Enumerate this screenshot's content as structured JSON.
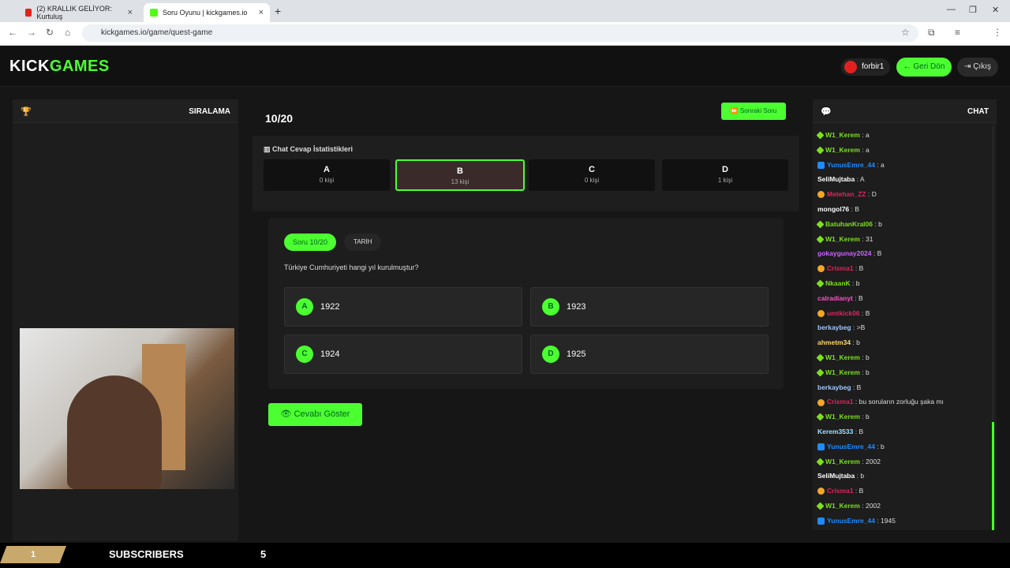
{
  "browser": {
    "tab1": "(2) KRALLIK GELİYOR: Kurtuluş",
    "tab2": "Soru Oyunu | kickgames.io",
    "url": "kickgames.io/game/quest-game"
  },
  "header": {
    "logo_kick": "KICK",
    "logo_games": "GAMES",
    "username": "forbir1",
    "back": "Geri Dön",
    "exit": "Çıkış"
  },
  "ranking": {
    "title": "SIRALAMA"
  },
  "game": {
    "question_number": "10/20",
    "next": "Sonraki Soru",
    "stats_title": "Chat Cevap İstatistikleri",
    "stats": [
      {
        "letter": "A",
        "count": "0 kişi"
      },
      {
        "letter": "B",
        "count": "13 kişi"
      },
      {
        "letter": "C",
        "count": "0 kişi"
      },
      {
        "letter": "D",
        "count": "1 kişi"
      }
    ],
    "pill": "Soru 10/20",
    "category": "TARİH",
    "question": "Türkiye Cumhuriyeti hangi yıl kurulmuştur?",
    "answers": [
      {
        "letter": "A",
        "text": "1922"
      },
      {
        "letter": "B",
        "text": "1923"
      },
      {
        "letter": "C",
        "text": "1924"
      },
      {
        "letter": "D",
        "text": "1925"
      }
    ],
    "show_answer": "Cevabı Göster"
  },
  "chat": {
    "title": "CHAT",
    "messages": [
      {
        "name": "W1_Kerem",
        "color": "#7ddf1e",
        "text": "a"
      },
      {
        "name": "W1_Kerem",
        "color": "#7ddf1e",
        "text": "a"
      },
      {
        "name": "YunusEmre_44",
        "color": "#1e8cff",
        "text": "a"
      },
      {
        "name": "SeliMujtaba",
        "color": "#ffffff",
        "text": "A"
      },
      {
        "name": "Metehan_ZZ",
        "color": "#e0245e",
        "text": "D"
      },
      {
        "name": "mongol76",
        "color": "#ffffff",
        "text": "B"
      },
      {
        "name": "BatuhanKral06",
        "color": "#7ddf1e",
        "text": "b"
      },
      {
        "name": "W1_Kerem",
        "color": "#7ddf1e",
        "text": "31"
      },
      {
        "name": "gokaygunay2024",
        "color": "#c864ff",
        "text": "B"
      },
      {
        "name": "Crisma1",
        "color": "#e0245e",
        "text": "B"
      },
      {
        "name": "NkaanK",
        "color": "#7ddf1e",
        "text": "b"
      },
      {
        "name": "calradianyt",
        "color": "#ff4fc8",
        "text": "B"
      },
      {
        "name": "umtkick06",
        "color": "#e0245e",
        "text": "B"
      },
      {
        "name": "berkaybeg",
        "color": "#9fc7ff",
        "text": ">B"
      },
      {
        "name": "ahmetm34",
        "color": "#ffd966",
        "text": "b"
      },
      {
        "name": "W1_Kerem",
        "color": "#7ddf1e",
        "text": "b"
      },
      {
        "name": "W1_Kerem",
        "color": "#7ddf1e",
        "text": "b"
      },
      {
        "name": "berkaybeg",
        "color": "#9fc7ff",
        "text": "B"
      },
      {
        "name": "Crisma1",
        "color": "#e0245e",
        "text": "bu soruların zorluğu şaka mı"
      },
      {
        "name": "W1_Kerem",
        "color": "#7ddf1e",
        "text": "b"
      },
      {
        "name": "Kerem3533",
        "color": "#9fe0ff",
        "text": "B"
      },
      {
        "name": "YunusEmre_44",
        "color": "#1e8cff",
        "text": "b"
      },
      {
        "name": "W1_Kerem",
        "color": "#7ddf1e",
        "text": "2002"
      },
      {
        "name": "SeliMujtaba",
        "color": "#ffffff",
        "text": "b"
      },
      {
        "name": "Crisma1",
        "color": "#e0245e",
        "text": "B"
      },
      {
        "name": "W1_Kerem",
        "color": "#7ddf1e",
        "text": "2002"
      },
      {
        "name": "YunusEmre_44",
        "color": "#1e8cff",
        "text": "1945"
      }
    ]
  },
  "ticker": {
    "rank": "1",
    "label": "SUBSCRIBERS",
    "count": "5"
  }
}
